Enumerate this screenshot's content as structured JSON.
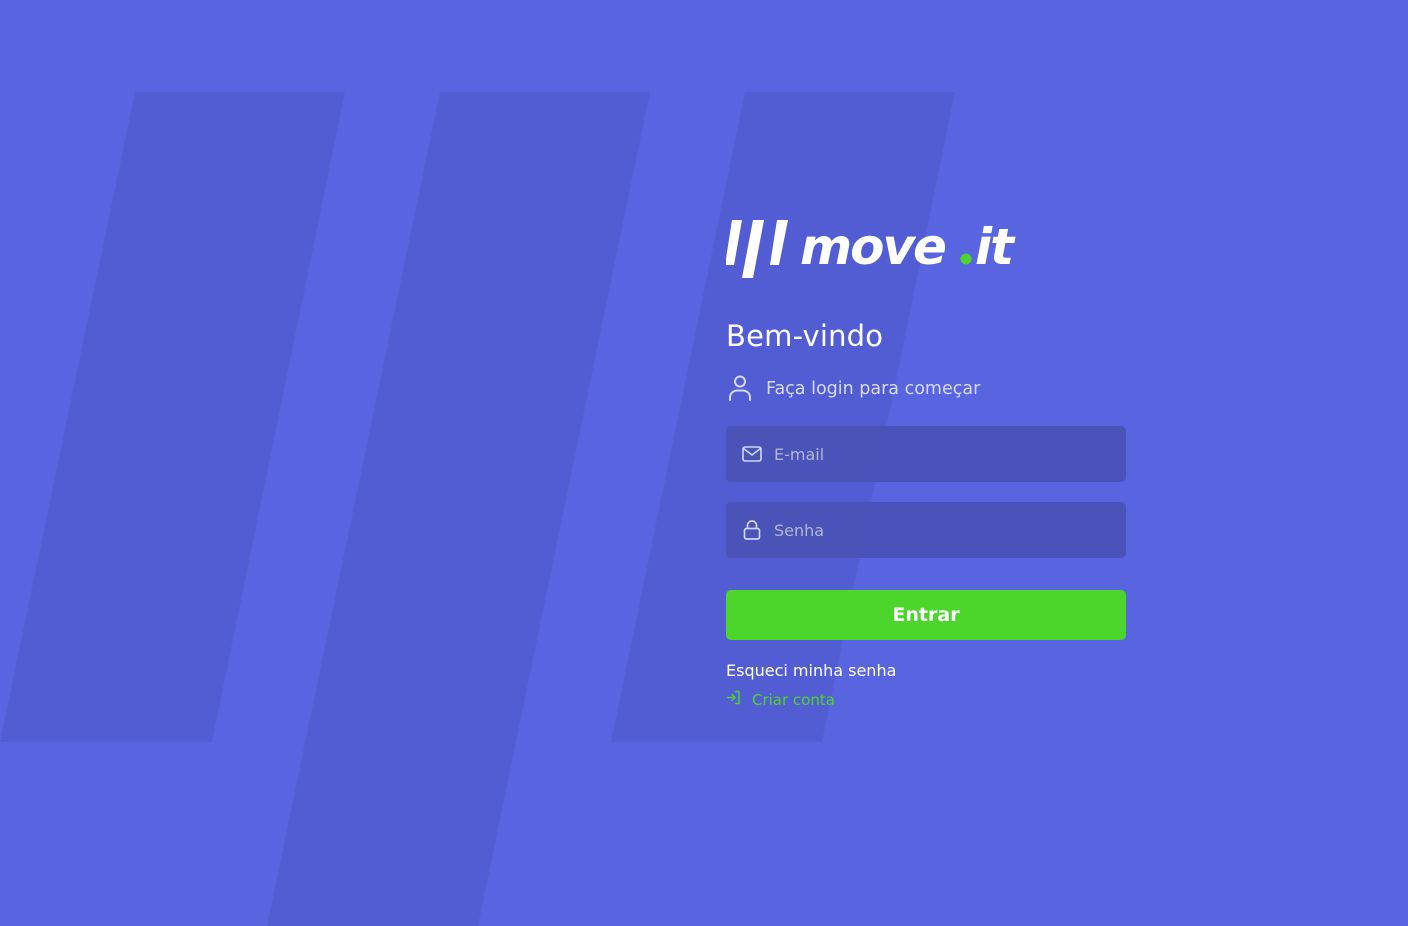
{
  "colors": {
    "background": "#5965e0",
    "stripe": "#4f58c9",
    "field_background": "#4953b8",
    "accent_green": "#4cd62b",
    "text_white": "#ffffff",
    "subtitle_text": "#d6dafa",
    "placeholder_text": "#b7b9d6"
  },
  "brand": {
    "name_part1": "move",
    "name_dot": ".",
    "name_part2": "it"
  },
  "login": {
    "welcome": "Bem-vindo",
    "subtitle": "Faça login para começar",
    "subtitle_icon": "user-icon",
    "email": {
      "icon": "mail-icon",
      "placeholder": "E-mail",
      "value": ""
    },
    "password": {
      "icon": "lock-icon",
      "placeholder": "Senha",
      "value": ""
    },
    "submit_label": "Entrar",
    "forgot_label": "Esqueci minha senha",
    "create_label": "Criar conta",
    "create_icon": "sign-in-icon"
  }
}
